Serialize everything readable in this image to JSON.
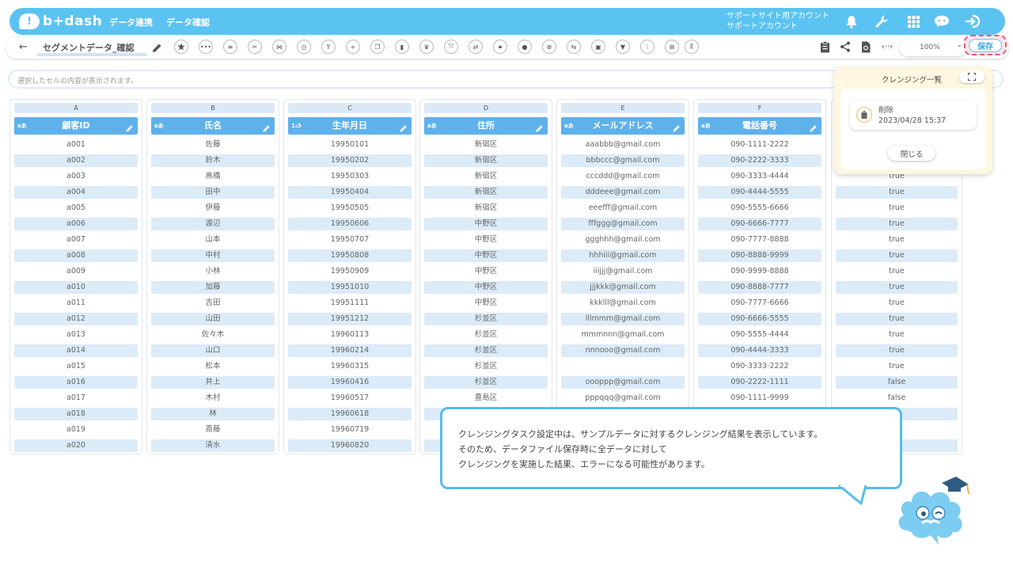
{
  "header": {
    "logo_mark": "!",
    "logo_text": "b+dash",
    "nav": [
      "データ連携",
      "データ確認"
    ],
    "account_line1": "サポートサイト用アカウント",
    "account_line2": "サポートアカウント",
    "icons": [
      "bell-icon",
      "wrench-icon",
      "grid-icon",
      "chat-icon",
      "logout-icon"
    ]
  },
  "toolbar": {
    "back": "←",
    "title": "セグメントデータ_確認",
    "zoom": "100%",
    "save_label": "保存"
  },
  "formula_bar": {
    "placeholder": "選択したセルの内容が表示されます。"
  },
  "columns": [
    {
      "letter": "A",
      "type": "aあ",
      "name": "顧客ID",
      "values": [
        "a001",
        "a002",
        "a003",
        "a004",
        "a005",
        "a006",
        "a007",
        "a008",
        "a009",
        "a010",
        "a011",
        "a012",
        "a013",
        "a014",
        "a015",
        "a016",
        "a017",
        "a018",
        "a019",
        "a020"
      ]
    },
    {
      "letter": "B",
      "type": "aあ",
      "name": "氏名",
      "values": [
        "佐藤",
        "鈴木",
        "高橋",
        "田中",
        "伊藤",
        "渡辺",
        "山本",
        "中村",
        "小林",
        "加藤",
        "吉田",
        "山田",
        "佐々木",
        "山口",
        "松本",
        "井上",
        "木村",
        "林",
        "斎藤",
        "清水"
      ]
    },
    {
      "letter": "C",
      "type": "1₂3",
      "name": "生年月日",
      "values": [
        "19950101",
        "19950202",
        "19950303",
        "19950404",
        "19950505",
        "19950606",
        "19950707",
        "19950808",
        "19950909",
        "19951010",
        "19951111",
        "19951212",
        "19960113",
        "19960214",
        "19960315",
        "19960416",
        "19960517",
        "19960618",
        "19960719",
        "19960820"
      ]
    },
    {
      "letter": "D",
      "type": "aあ",
      "name": "住所",
      "values": [
        "新宿区",
        "新宿区",
        "新宿区",
        "新宿区",
        "新宿区",
        "中野区",
        "中野区",
        "中野区",
        "中野区",
        "中野区",
        "中野区",
        "杉並区",
        "杉並区",
        "杉並区",
        "杉並区",
        "杉並区",
        "豊島区",
        "",
        "",
        ""
      ]
    },
    {
      "letter": "E",
      "type": "aあ",
      "name": "メールアドレス",
      "values": [
        "aaabbb@gmail.com",
        "bbbccc@gmail.com",
        "cccddd@gmail.com",
        "dddeee@gmail.com",
        "eeefff@gmail.com",
        "fffggg@gmail.com",
        "ggghhh@gmail.com",
        "hhhiii@gmail.com",
        "iiijjj@gmail.com",
        "jjjkkk@gmail.com",
        "kkklll@gmail.com",
        "lllmmm@gmail.com",
        "mmmnnn@gmail.com",
        "nnnooo@gmail.com",
        "",
        "oooppp@gmail.com",
        "pppqqq@gmail.com",
        "",
        "",
        ""
      ]
    },
    {
      "letter": "F",
      "type": "aあ",
      "name": "電話番号",
      "values": [
        "090-1111-2222",
        "090-2222-3333",
        "090-3333-4444",
        "090-4444-5555",
        "090-5555-6666",
        "090-6666-7777",
        "090-7777-8888",
        "090-8888-9999",
        "090-9999-8888",
        "090-8888-7777",
        "090-7777-6666",
        "090-6666-5555",
        "090-5555-4444",
        "090-4444-3333",
        "090-3333-2222",
        "090-2222-1111",
        "090-1111-9999",
        "",
        "",
        ""
      ]
    },
    {
      "letter": "",
      "type": "",
      "name": "",
      "values": [
        "",
        "",
        "true",
        "true",
        "true",
        "true",
        "true",
        "true",
        "true",
        "true",
        "true",
        "true",
        "true",
        "true",
        "true",
        "false",
        "false",
        "",
        "",
        ""
      ]
    }
  ],
  "cleansing_panel": {
    "title": "クレンジング一覧",
    "item_label": "削除",
    "item_date": "2023/04/28 15:37",
    "close_label": "閉じる"
  },
  "notice": {
    "line1": "クレンジングタスク設定中は、サンプルデータに対するクレンジング結果を表示しています。",
    "line2": "そのため、データファイル保存時に全データに対して",
    "line3": "クレンジングを実施した結果、エラーになる可能性があります。"
  },
  "colors": {
    "brand": "#5bc3f1",
    "column_header": "#5fb1ec",
    "row_alt": "#dcebf8",
    "save_highlight": "#e45a6f",
    "panel_bg": "#fff7e0"
  }
}
